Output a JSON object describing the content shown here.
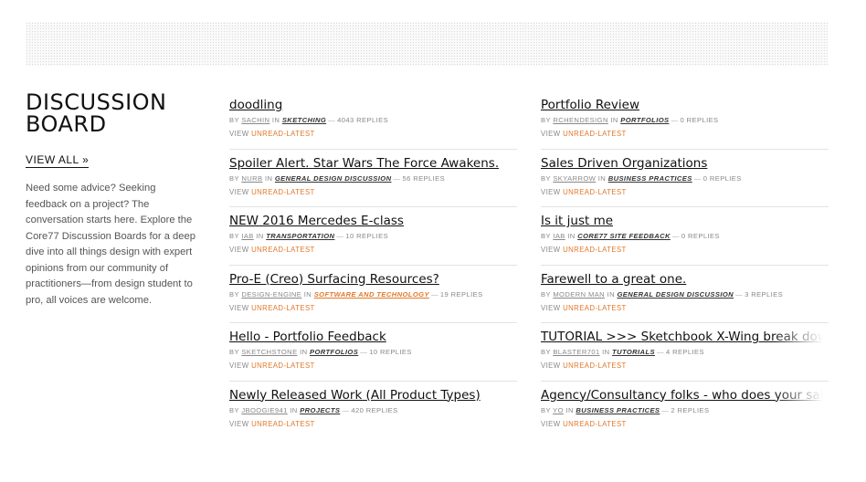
{
  "sidebar": {
    "title_line1": "DISCUSSION",
    "title_line2": "BOARD",
    "view_all": "VIEW ALL »",
    "description": "Need some advice? Seeking feedback on a project? The conversation starts here. Explore the Core77 Discussion Boards for a deep dive into all things design with expert opinions from our community of practitioners—from design student to pro, all voices are welcome."
  },
  "labels": {
    "by": "BY",
    "in": "IN",
    "view": "VIEW",
    "unread": "UNREAD",
    "sep": "-",
    "latest": "LATEST",
    "dash": "—"
  },
  "colors": {
    "accent": "#e0782a"
  },
  "posts_left": [
    {
      "title": "doodling",
      "author": "SACHIN",
      "category": "SKETCHING",
      "replies": "4043 REPLIES"
    },
    {
      "title": "Spoiler Alert. Star Wars The Force Awakens.",
      "author": "NURB",
      "category": "GENERAL DESIGN DISCUSSION",
      "replies": "56 REPLIES"
    },
    {
      "title": "NEW 2016 Mercedes E-class",
      "author": "IAB",
      "category": "TRANSPORTATION",
      "replies": "10 REPLIES"
    },
    {
      "title": "Pro-E (Creo) Surfacing Resources?",
      "author": "DESIGN-ENGINE",
      "category": "SOFTWARE AND TECHNOLOGY",
      "replies": "19 REPLIES"
    },
    {
      "title": "Hello - Portfolio Feedback",
      "author": "SKETCHSTONE",
      "category": "PORTFOLIOS",
      "replies": "10 REPLIES"
    },
    {
      "title": "Newly Released Work (All Product Types)",
      "author": "JBOOGIE941",
      "category": "PROJECTS",
      "replies": "420 REPLIES"
    }
  ],
  "posts_right": [
    {
      "title": "Portfolio Review",
      "author": "RCHENDESIGN",
      "category": "PORTFOLIOS",
      "replies": "0 REPLIES"
    },
    {
      "title": "Sales Driven Organizations",
      "author": "SKYARROW",
      "category": "BUSINESS PRACTICES",
      "replies": "0 REPLIES"
    },
    {
      "title": "Is it just me",
      "author": "IAB",
      "category": "CORE77 SITE FEEDBACK",
      "replies": "0 REPLIES"
    },
    {
      "title": "Farewell to a great one.",
      "author": "MODERN MAN",
      "category": "GENERAL DESIGN DISCUSSION",
      "replies": "3 REPLIES"
    },
    {
      "title": "TUTORIAL >>> Sketchbook X-Wing break down",
      "author": "BLASTER701",
      "category": "TUTORIALS",
      "replies": "4 REPLIES"
    },
    {
      "title": "Agency/Consultancy folks - who does your sales?",
      "author": "YO",
      "category": "BUSINESS PRACTICES",
      "replies": "2 REPLIES"
    }
  ]
}
